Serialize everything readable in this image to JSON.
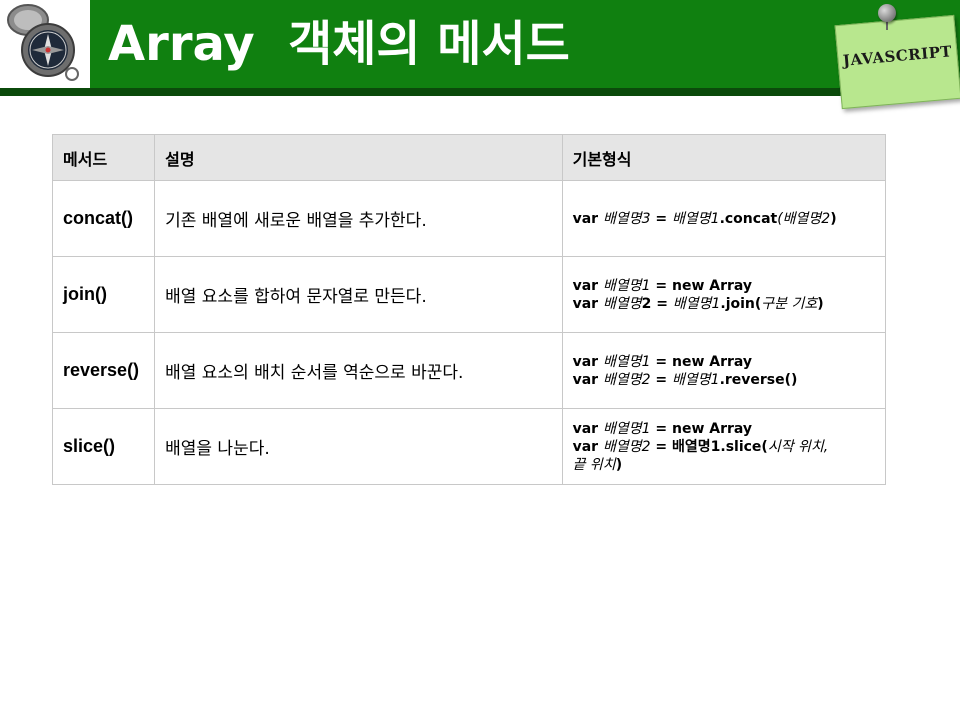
{
  "header": {
    "title": "Array  객체의 메서드",
    "note_label": "JAVASCRIPT"
  },
  "table": {
    "headers": [
      "메서드",
      "설명",
      "기본형식"
    ],
    "rows": [
      {
        "method": "concat()",
        "description": "기존 배열에 새로운 배열을 추가한다.",
        "form": [
          [
            {
              "t": "var ",
              "s": "b"
            },
            {
              "t": "배열명3",
              "s": "i"
            },
            {
              "t": " = ",
              "s": "b"
            },
            {
              "t": "배열명1",
              "s": "i"
            },
            {
              "t": ".concat",
              "s": "b"
            },
            {
              "t": "(배열명2",
              "s": "i"
            },
            {
              "t": ")",
              "s": "b"
            }
          ]
        ]
      },
      {
        "method": "join()",
        "description": "배열 요소를 합하여 문자열로 만든다.",
        "form": [
          [
            {
              "t": "var ",
              "s": "b"
            },
            {
              "t": "배열명1",
              "s": "i"
            },
            {
              "t": " = new Array",
              "s": "b"
            }
          ],
          [
            {
              "t": "var ",
              "s": "b"
            },
            {
              "t": "배열명",
              "s": "i"
            },
            {
              "t": "2 = ",
              "s": "b"
            },
            {
              "t": "배열명1",
              "s": "i"
            },
            {
              "t": ".join(",
              "s": "b"
            },
            {
              "t": "구분 기호",
              "s": "i"
            },
            {
              "t": ")",
              "s": "b"
            }
          ]
        ]
      },
      {
        "method": "reverse()",
        "description": "배열 요소의 배치 순서를 역순으로 바꾼다.",
        "form": [
          [
            {
              "t": "var ",
              "s": "b"
            },
            {
              "t": "배열명1",
              "s": "i"
            },
            {
              "t": " = new Array",
              "s": "b"
            }
          ],
          [
            {
              "t": "var ",
              "s": "b"
            },
            {
              "t": "배열명2",
              "s": "i"
            },
            {
              "t": " = ",
              "s": "b"
            },
            {
              "t": "배열명1",
              "s": "i"
            },
            {
              "t": ".reverse()",
              "s": "b"
            }
          ]
        ]
      },
      {
        "method": "slice()",
        "description": "배열을 나눈다.",
        "form": [
          [
            {
              "t": "var ",
              "s": "b"
            },
            {
              "t": "배열명1",
              "s": "i"
            },
            {
              "t": " = new Array",
              "s": "b"
            }
          ],
          [
            {
              "t": "var ",
              "s": "b"
            },
            {
              "t": "배열명2",
              "s": "i"
            },
            {
              "t": " = 배열명1.slice(",
              "s": "b"
            },
            {
              "t": "시작 위치,",
              "s": "i"
            }
          ],
          [
            {
              "t": "끝 위치",
              "s": "i"
            },
            {
              "t": ")",
              "s": "b"
            }
          ]
        ]
      }
    ]
  },
  "colors": {
    "header_green": "#108010",
    "header_dark": "#0b4a0b",
    "note": "#b8e78e",
    "table_header_bg": "#e5e5e5",
    "border": "#c8c8c8"
  },
  "icons": {
    "logo": "compass-icon",
    "pin": "pushpin-icon"
  }
}
